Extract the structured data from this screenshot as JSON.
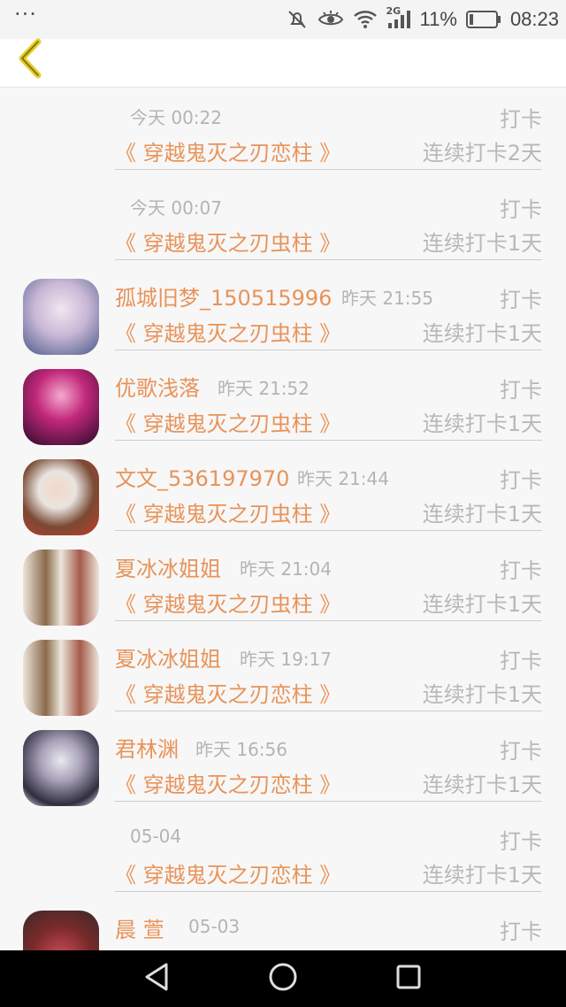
{
  "status_bar": {
    "dots": "···",
    "network": "2G",
    "battery": "11%",
    "time": "08:23"
  },
  "header": {
    "back_icon": "chevron-left-icon"
  },
  "items": [
    {
      "user": "",
      "time": "今天 00:22",
      "tag": "打卡",
      "book": "《 穿越鬼灭之刃恋柱 》",
      "streak": "连续打卡2天",
      "avatar": false
    },
    {
      "user": "",
      "time": "今天 00:07",
      "tag": "打卡",
      "book": "《 穿越鬼灭之刃虫柱 》",
      "streak": "连续打卡1天",
      "avatar": false
    },
    {
      "user": "孤城旧梦_150515996",
      "time": "昨天 21:55",
      "tag": "打卡",
      "book": "《 穿越鬼灭之刃虫柱 》",
      "streak": "连续打卡1天",
      "avatar": true,
      "avatar_colors": [
        "#4a5a8a",
        "#c9b7d6",
        "#f1e6ef"
      ]
    },
    {
      "user": "优歌浅落",
      "time": "昨天 21:52",
      "tag": "打卡",
      "book": "《 穿越鬼灭之刃虫柱 》",
      "streak": "连续打卡1天",
      "avatar": true,
      "avatar_colors": [
        "#2a0a2a",
        "#c2287a",
        "#f5a9cf"
      ]
    },
    {
      "user": "文文_536197970",
      "time": "昨天 21:44",
      "tag": "打卡",
      "book": "《 穿越鬼灭之刃虫柱 》",
      "streak": "连续打卡1天",
      "avatar": true,
      "avatar_colors": [
        "#e9e4e0",
        "#c23a2a",
        "#7a4a34"
      ]
    },
    {
      "user": "夏冰冰姐姐",
      "time": "昨天 21:04",
      "tag": "打卡",
      "book": "《 穿越鬼灭之刃虫柱 》",
      "streak": "连续打卡1天",
      "avatar": true,
      "avatar_colors": [
        "#ece6da",
        "#8a6a4a",
        "#a45a4a"
      ]
    },
    {
      "user": "夏冰冰姐姐",
      "time": "昨天 19:17",
      "tag": "打卡",
      "book": "《 穿越鬼灭之刃恋柱 》",
      "streak": "连续打卡1天",
      "avatar": true,
      "avatar_colors": [
        "#ece6da",
        "#8a6a4a",
        "#a45a4a"
      ]
    },
    {
      "user": "君林渊",
      "time": "昨天 16:56",
      "tag": "打卡",
      "book": "《 穿越鬼灭之刃恋柱 》",
      "streak": "连续打卡1天",
      "avatar": true,
      "avatar_colors": [
        "#e8eaee",
        "#2e2e3e",
        "#a8a0b8"
      ]
    },
    {
      "user": "",
      "time": "05-04",
      "tag": "打卡",
      "book": "《 穿越鬼灭之刃恋柱 》",
      "streak": "连续打卡1天",
      "avatar": false
    },
    {
      "user": "晨 萱",
      "time": "05-03",
      "tag": "打卡",
      "book": "",
      "streak": "",
      "avatar": true,
      "avatar_colors": [
        "#7a2a2a",
        "#c84a5a",
        "#3a2a2a"
      ]
    }
  ],
  "nav": {
    "back": "back-triangle-icon",
    "home": "home-circle-icon",
    "recents": "recents-square-icon"
  }
}
